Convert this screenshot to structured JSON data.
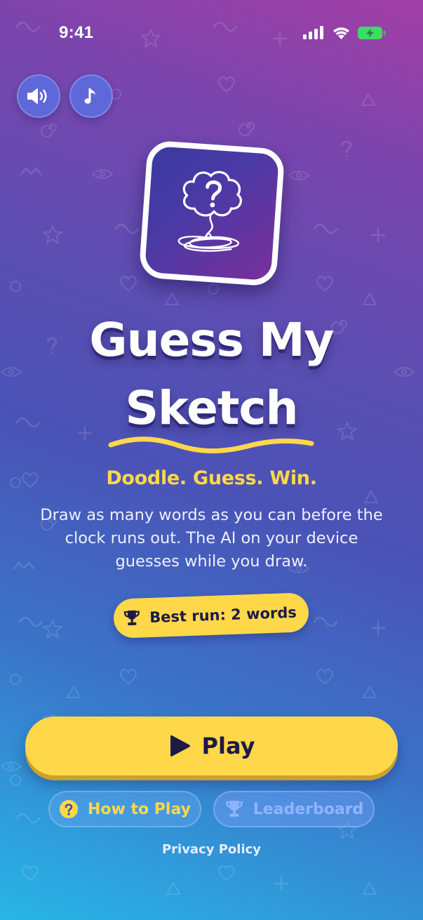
{
  "status_bar": {
    "time": "9:41"
  },
  "controls": {
    "sound_icon": "speaker-icon",
    "music_icon": "music-note-icon"
  },
  "logo": {
    "icon": "brain-question-sketch-icon"
  },
  "title": {
    "line1": "Guess My",
    "line2": "Sketch"
  },
  "tagline": "Doodle. Guess. Win.",
  "description": "Draw as many words as you can before the clock runs out. The AI on your device guesses while you draw.",
  "best_run": {
    "label": "Best run: 2 words",
    "icon": "trophy-icon"
  },
  "actions": {
    "play_label": "Play",
    "play_icon": "play-icon",
    "how_to_play_label": "How to Play",
    "how_to_play_icon": "question-circle-icon",
    "leaderboard_label": "Leaderboard",
    "leaderboard_icon": "trophy-icon"
  },
  "footer": {
    "privacy_label": "Privacy Policy"
  },
  "colors": {
    "accent_yellow": "#ffd84a",
    "dark_text": "#1e1a46",
    "gradient_top": "#a23ea6",
    "gradient_mid": "#4b52b6",
    "gradient_bottom": "#28b6e6"
  }
}
